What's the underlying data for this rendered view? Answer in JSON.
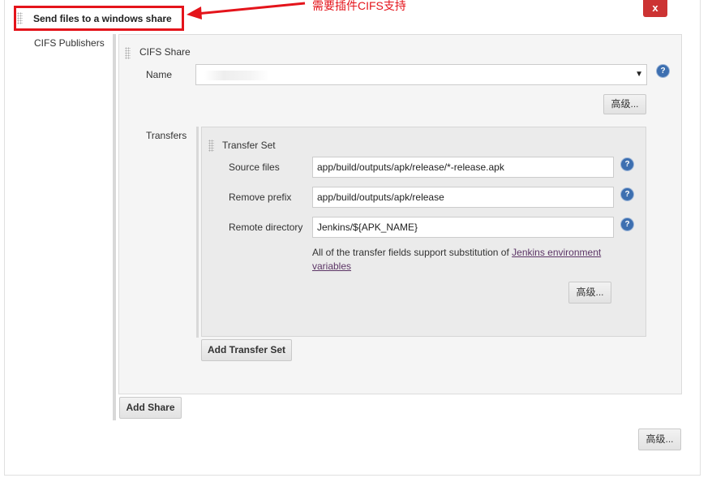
{
  "header": {
    "section_title": "Send files to a windows share",
    "annotation": "需要插件CIFS支持",
    "close_label": "x"
  },
  "publishers_label": "CIFS Publishers",
  "cifs_share": {
    "title": "CIFS Share",
    "name_label": "Name",
    "name_value": "",
    "advanced_label": "高级...",
    "transfers_label": "Transfers"
  },
  "transfer_set": {
    "title": "Transfer Set",
    "source_files_label": "Source files",
    "source_files_value": "app/build/outputs/apk/release/*-release.apk",
    "remove_prefix_label": "Remove prefix",
    "remove_prefix_value": "app/build/outputs/apk/release",
    "remote_directory_label": "Remote directory",
    "remote_directory_value": "Jenkins/${APK_NAME}",
    "note_text": "All of the transfer fields support substitution of",
    "note_link_1": "Jenkins environment",
    "note_link_2": "variables",
    "advanced_label": "高级..."
  },
  "buttons": {
    "add_transfer_set": "Add Transfer Set",
    "add_share": "Add Share",
    "advanced_bottom": "高级..."
  },
  "colors": {
    "annotation_red": "#e4141b",
    "help_blue": "#3d6fb0",
    "link_purple": "#5c3566"
  }
}
